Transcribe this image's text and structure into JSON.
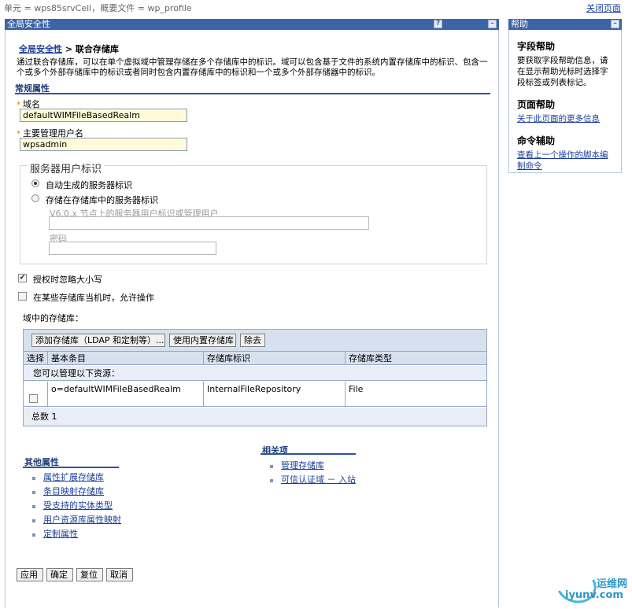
{
  "topbar": {
    "scope": "单元 = wps85srvCell，概要文件 = wp_profile",
    "close_link": "关闭页面"
  },
  "panel": {
    "title": "全局安全性",
    "help_btn": "?",
    "min_btn": "–"
  },
  "breadcrumb": {
    "link": "全局安全性",
    "sep": ">",
    "current": "联合存储库"
  },
  "description": "通过联合存储库，可以在单个虚拟域中管理存储在多个存储库中的标识。域可以包含基于文件的系统内置存储库中的标识、包含一个或多个外部存储库中的标识或者同时包含内置存储库中的标识和一个或多个外部存储器中的标识。",
  "general": {
    "section_title": "常规属性",
    "required_mark": "*",
    "realm_label": "域名",
    "realm_value": "defaultWIMFileBasedRealm",
    "admin_label": "主要管理用户名",
    "admin_value": "wpsadmin"
  },
  "server_identity": {
    "legend": "服务器用户标识",
    "opt_auto": "自动生成的服务器标识",
    "opt_stored": "存储在存储库中的服务器标识",
    "v6_label": "V6.0.x 节点上的服务器用户标识或管理用户",
    "v6_value": "",
    "password_label": "密码",
    "password_value": ""
  },
  "options": {
    "ignore_case": "授权时忽略大小写",
    "ignore_case_checked": true,
    "allow_down": "在某些存储库当机时，允许操作",
    "allow_down_checked": false
  },
  "repos": {
    "caption": "域中的存储库：",
    "btn_add": "添加存储库（LDAP 和定制等）...",
    "btn_builtin": "使用内置存储库",
    "btn_remove": "除去",
    "col_select": "选择",
    "col_base": "基本条目",
    "col_id": "存储库标识",
    "col_type": "存储库类型",
    "sub_note": "您可以管理以下资源：",
    "rows": [
      {
        "base": "o=defaultWIMFileBasedRealm",
        "id": "InternalFileRepository",
        "type": "File"
      }
    ],
    "total_label": "总数",
    "total_value": "1"
  },
  "additional": {
    "title": "其他属性",
    "items": [
      "属性扩展存储库",
      "条目映射存储库",
      "受支持的实体类型",
      "用户资源库属性映射",
      "定制属性"
    ]
  },
  "related": {
    "title": "相关项",
    "items": [
      "管理存储库",
      "可信认证域 － 入站"
    ]
  },
  "buttons": {
    "apply": "应用",
    "ok": "确定",
    "reset": "复位",
    "cancel": "取消"
  },
  "help": {
    "title": "帮助",
    "min_btn": "–",
    "field_title": "字段帮助",
    "field_text": "要获取字段帮助信息，请在显示帮助光标时选择字段标签或列表标记。",
    "page_title": "页面帮助",
    "page_link": "关于此页面的更多信息",
    "cmd_title": "命令辅助",
    "cmd_link": "查看上一个操作的脚本编制命令"
  },
  "watermark": {
    "cn": "运维网",
    "url": "iyunv.com"
  },
  "colors": {
    "header_blue": "#3c64a6",
    "link_blue": "#1a3e9b",
    "section_blue": "#2f5494",
    "required_bg": "#fffbd9",
    "table_header_bg": "#d7e0ef"
  }
}
